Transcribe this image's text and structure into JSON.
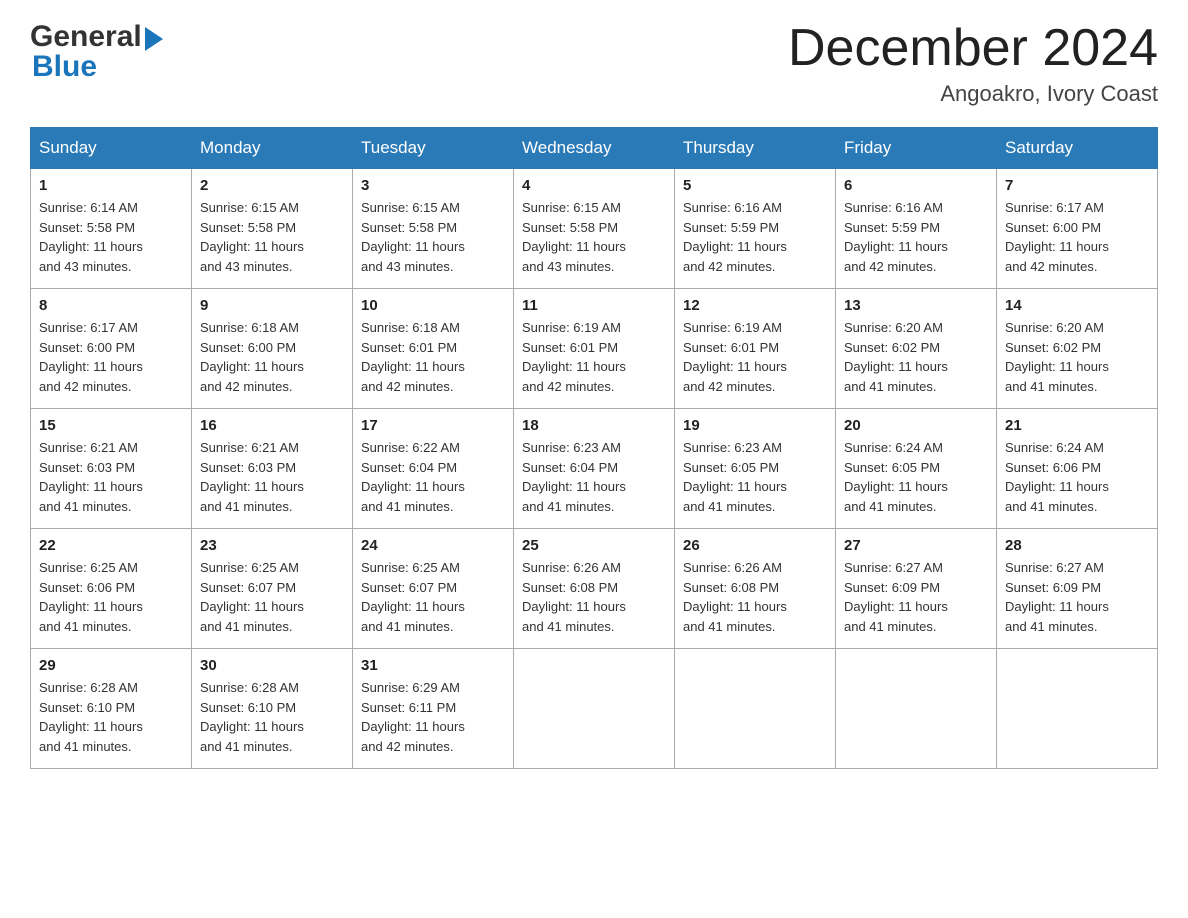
{
  "header": {
    "logo_general": "General",
    "logo_blue": "Blue",
    "month_title": "December 2024",
    "location": "Angoakro, Ivory Coast"
  },
  "days_of_week": [
    "Sunday",
    "Monday",
    "Tuesday",
    "Wednesday",
    "Thursday",
    "Friday",
    "Saturday"
  ],
  "weeks": [
    [
      {
        "num": "1",
        "sunrise": "6:14 AM",
        "sunset": "5:58 PM",
        "daylight": "11 hours and 43 minutes."
      },
      {
        "num": "2",
        "sunrise": "6:15 AM",
        "sunset": "5:58 PM",
        "daylight": "11 hours and 43 minutes."
      },
      {
        "num": "3",
        "sunrise": "6:15 AM",
        "sunset": "5:58 PM",
        "daylight": "11 hours and 43 minutes."
      },
      {
        "num": "4",
        "sunrise": "6:15 AM",
        "sunset": "5:58 PM",
        "daylight": "11 hours and 43 minutes."
      },
      {
        "num": "5",
        "sunrise": "6:16 AM",
        "sunset": "5:59 PM",
        "daylight": "11 hours and 42 minutes."
      },
      {
        "num": "6",
        "sunrise": "6:16 AM",
        "sunset": "5:59 PM",
        "daylight": "11 hours and 42 minutes."
      },
      {
        "num": "7",
        "sunrise": "6:17 AM",
        "sunset": "6:00 PM",
        "daylight": "11 hours and 42 minutes."
      }
    ],
    [
      {
        "num": "8",
        "sunrise": "6:17 AM",
        "sunset": "6:00 PM",
        "daylight": "11 hours and 42 minutes."
      },
      {
        "num": "9",
        "sunrise": "6:18 AM",
        "sunset": "6:00 PM",
        "daylight": "11 hours and 42 minutes."
      },
      {
        "num": "10",
        "sunrise": "6:18 AM",
        "sunset": "6:01 PM",
        "daylight": "11 hours and 42 minutes."
      },
      {
        "num": "11",
        "sunrise": "6:19 AM",
        "sunset": "6:01 PM",
        "daylight": "11 hours and 42 minutes."
      },
      {
        "num": "12",
        "sunrise": "6:19 AM",
        "sunset": "6:01 PM",
        "daylight": "11 hours and 42 minutes."
      },
      {
        "num": "13",
        "sunrise": "6:20 AM",
        "sunset": "6:02 PM",
        "daylight": "11 hours and 41 minutes."
      },
      {
        "num": "14",
        "sunrise": "6:20 AM",
        "sunset": "6:02 PM",
        "daylight": "11 hours and 41 minutes."
      }
    ],
    [
      {
        "num": "15",
        "sunrise": "6:21 AM",
        "sunset": "6:03 PM",
        "daylight": "11 hours and 41 minutes."
      },
      {
        "num": "16",
        "sunrise": "6:21 AM",
        "sunset": "6:03 PM",
        "daylight": "11 hours and 41 minutes."
      },
      {
        "num": "17",
        "sunrise": "6:22 AM",
        "sunset": "6:04 PM",
        "daylight": "11 hours and 41 minutes."
      },
      {
        "num": "18",
        "sunrise": "6:23 AM",
        "sunset": "6:04 PM",
        "daylight": "11 hours and 41 minutes."
      },
      {
        "num": "19",
        "sunrise": "6:23 AM",
        "sunset": "6:05 PM",
        "daylight": "11 hours and 41 minutes."
      },
      {
        "num": "20",
        "sunrise": "6:24 AM",
        "sunset": "6:05 PM",
        "daylight": "11 hours and 41 minutes."
      },
      {
        "num": "21",
        "sunrise": "6:24 AM",
        "sunset": "6:06 PM",
        "daylight": "11 hours and 41 minutes."
      }
    ],
    [
      {
        "num": "22",
        "sunrise": "6:25 AM",
        "sunset": "6:06 PM",
        "daylight": "11 hours and 41 minutes."
      },
      {
        "num": "23",
        "sunrise": "6:25 AM",
        "sunset": "6:07 PM",
        "daylight": "11 hours and 41 minutes."
      },
      {
        "num": "24",
        "sunrise": "6:25 AM",
        "sunset": "6:07 PM",
        "daylight": "11 hours and 41 minutes."
      },
      {
        "num": "25",
        "sunrise": "6:26 AM",
        "sunset": "6:08 PM",
        "daylight": "11 hours and 41 minutes."
      },
      {
        "num": "26",
        "sunrise": "6:26 AM",
        "sunset": "6:08 PM",
        "daylight": "11 hours and 41 minutes."
      },
      {
        "num": "27",
        "sunrise": "6:27 AM",
        "sunset": "6:09 PM",
        "daylight": "11 hours and 41 minutes."
      },
      {
        "num": "28",
        "sunrise": "6:27 AM",
        "sunset": "6:09 PM",
        "daylight": "11 hours and 41 minutes."
      }
    ],
    [
      {
        "num": "29",
        "sunrise": "6:28 AM",
        "sunset": "6:10 PM",
        "daylight": "11 hours and 41 minutes."
      },
      {
        "num": "30",
        "sunrise": "6:28 AM",
        "sunset": "6:10 PM",
        "daylight": "11 hours and 41 minutes."
      },
      {
        "num": "31",
        "sunrise": "6:29 AM",
        "sunset": "6:11 PM",
        "daylight": "11 hours and 42 minutes."
      },
      null,
      null,
      null,
      null
    ]
  ],
  "labels": {
    "sunrise": "Sunrise:",
    "sunset": "Sunset:",
    "daylight": "Daylight:"
  }
}
